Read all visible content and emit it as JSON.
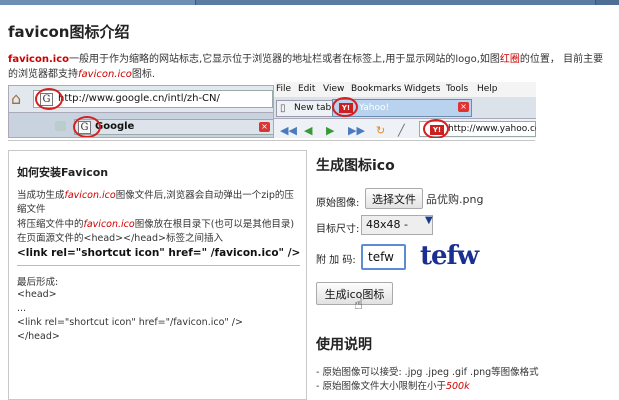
{
  "page": {
    "title": "favicon图标介绍",
    "intro": {
      "term": "favicon.ico",
      "part1": "一般用于作为缩略的网站标志,它显示位于浏览器的地址栏或者在标签上,用于显示网站的logo,如图",
      "highlight": "红圈",
      "part2": "的位置，  目前主要的浏览器都支持",
      "term2": "favicon.ico",
      "part3": "图标."
    }
  },
  "browser_demo": {
    "address_url": "http://www.google.cn/intl/zh-CN/",
    "tab_label": "Google",
    "menu": [
      "File",
      "Edit",
      "View",
      "Bookmarks",
      "Widgets",
      "Tools",
      "Help"
    ],
    "new_tab_label": "New tab",
    "yahoo_tab_label": "Yahoo!",
    "yahoo_url": "http://www.yahoo.com",
    "yahoo_fav_text": "Y!",
    "google_fav_text": "G"
  },
  "howto": {
    "title": "如何安装Favicon",
    "p1_a": "当成功生成",
    "p1_term": "favicon.ico",
    "p1_b": "图像文件后,浏览器会自动弹出一个zip的压缩文件",
    "p2_a": "将压缩文件中的",
    "p2_term": "favicon.ico",
    "p2_b": "图像放在根目录下(也可以是其他目录)",
    "p3": "在页面源文件的<head></head>标签之间插入",
    "code": "<link rel=\"shortcut icon\" href=\" /favicon.ico\" />",
    "final_label": "最后形成:",
    "head_open": "<head>",
    "ellipsis": "...",
    "link_line": "<link rel=\"shortcut icon\" href=\"/favicon.ico\" />",
    "head_close": "</head>"
  },
  "generator": {
    "title": "生成图标ico",
    "source_label": "原始图像:",
    "file_button": "选择文件",
    "file_name": "品优购.png",
    "size_label": "目标尺寸:",
    "size_value": "48x48 -",
    "captcha_label": "附 加 码:",
    "captcha_value": "tefw",
    "captcha_image_text": "tefw",
    "submit_button": "生成ico图标"
  },
  "usage": {
    "title": "使用说明",
    "items": [
      "- 原始图像可以接受: .jpg .jpeg .gif .png等图像格式",
      "- 原始图像文件大小限制在小于"
    ],
    "limit": "500k"
  },
  "colors": {
    "accent_red": "#cc0000",
    "topbar": "#4d6f95",
    "captcha": "#1b2f93"
  }
}
